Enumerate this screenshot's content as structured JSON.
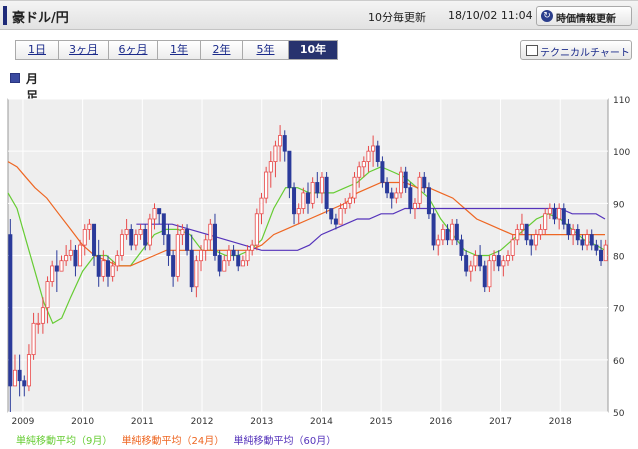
{
  "header": {
    "title": "豪ドル/円",
    "frequency": "10分毎更新",
    "timestamp": "18/10/02 11:04",
    "refresh_label": "時価情報更新"
  },
  "tabs": [
    {
      "label": "1日",
      "active": false
    },
    {
      "label": "3ヶ月",
      "active": false
    },
    {
      "label": "6ヶ月",
      "active": false
    },
    {
      "label": "1年",
      "active": false
    },
    {
      "label": "2年",
      "active": false
    },
    {
      "label": "5年",
      "active": false
    },
    {
      "label": "10年",
      "active": true
    }
  ],
  "technical_label": "テクニカルチャート",
  "section_title": "月足",
  "legend": [
    {
      "label": "単純移動平均（9月）",
      "color": "#66cc33"
    },
    {
      "label": "単純移動平均（24月）",
      "color": "#ee6622"
    },
    {
      "label": "単純移動平均（60月）",
      "color": "#5533bb"
    }
  ],
  "chart_data": {
    "type": "candlestick",
    "x_tick_labels": [
      "2009",
      "2010",
      "2011",
      "2012",
      "2013",
      "2014",
      "2015",
      "2016",
      "2017",
      "2018"
    ],
    "y_tick_labels": [
      "50",
      "60",
      "70",
      "80",
      "90",
      "100",
      "110"
    ],
    "ylim": [
      50,
      110
    ],
    "x_range": [
      "2008-10",
      "2018-10"
    ],
    "grid": true,
    "colors": {
      "up": "#e84a4a",
      "down": "#2a3a9a"
    },
    "candles": [
      [
        84,
        87,
        50,
        55
      ],
      [
        55,
        61,
        55,
        58
      ],
      [
        58,
        61,
        53,
        56
      ],
      [
        56,
        57,
        53,
        55
      ],
      [
        55,
        63,
        54,
        61
      ],
      [
        61,
        69,
        60,
        67
      ],
      [
        67,
        69,
        65,
        67
      ],
      [
        67,
        72,
        65,
        70
      ],
      [
        70,
        76,
        67,
        75
      ],
      [
        75,
        79,
        74,
        78
      ],
      [
        78,
        81,
        73,
        77
      ],
      [
        77,
        80,
        77,
        79
      ],
      [
        79,
        82,
        78,
        80
      ],
      [
        80,
        83,
        79,
        81
      ],
      [
        81,
        82,
        76,
        78
      ],
      [
        78,
        83,
        78,
        82
      ],
      [
        82,
        86,
        80,
        85
      ],
      [
        85,
        87,
        83,
        86
      ],
      [
        86,
        86,
        78,
        80
      ],
      [
        80,
        83,
        74,
        76
      ],
      [
        76,
        81,
        75,
        79
      ],
      [
        79,
        80,
        74,
        76
      ],
      [
        76,
        79,
        75,
        78
      ],
      [
        78,
        81,
        77,
        80
      ],
      [
        80,
        85,
        79,
        84
      ],
      [
        84,
        87,
        83,
        85
      ],
      [
        85,
        86,
        81,
        82
      ],
      [
        82,
        85,
        81,
        84
      ],
      [
        84,
        86,
        83,
        85
      ],
      [
        85,
        86,
        81,
        82
      ],
      [
        82,
        88,
        81,
        87
      ],
      [
        87,
        90,
        85,
        89
      ],
      [
        89,
        89,
        86,
        88
      ],
      [
        88,
        88,
        82,
        84
      ],
      [
        84,
        86,
        78,
        80
      ],
      [
        80,
        81,
        74,
        76
      ],
      [
        76,
        86,
        75,
        84
      ],
      [
        84,
        86,
        82,
        85
      ],
      [
        85,
        86,
        80,
        81
      ],
      [
        81,
        84,
        73,
        74
      ],
      [
        74,
        80,
        72,
        79
      ],
      [
        79,
        82,
        77,
        81
      ],
      [
        81,
        84,
        79,
        83
      ],
      [
        83,
        87,
        81,
        86
      ],
      [
        86,
        88,
        79,
        80
      ],
      [
        80,
        81,
        76,
        77
      ],
      [
        77,
        80,
        77,
        79
      ],
      [
        79,
        82,
        78,
        81
      ],
      [
        81,
        82,
        79,
        80
      ],
      [
        80,
        81,
        77,
        78
      ],
      [
        78,
        80,
        78,
        79
      ],
      [
        79,
        82,
        78,
        81
      ],
      [
        81,
        83,
        80,
        82
      ],
      [
        82,
        89,
        81,
        88
      ],
      [
        88,
        92,
        86,
        91
      ],
      [
        91,
        97,
        90,
        96
      ],
      [
        96,
        100,
        93,
        98
      ],
      [
        98,
        102,
        95,
        101
      ],
      [
        101,
        105,
        98,
        103
      ],
      [
        103,
        104,
        98,
        100
      ],
      [
        100,
        100,
        91,
        93
      ],
      [
        93,
        94,
        86,
        88
      ],
      [
        88,
        90,
        86,
        89
      ],
      [
        89,
        93,
        88,
        92
      ],
      [
        92,
        94,
        88,
        90
      ],
      [
        90,
        95,
        89,
        94
      ],
      [
        94,
        96,
        91,
        92
      ],
      [
        92,
        96,
        90,
        95
      ],
      [
        95,
        96,
        88,
        89
      ],
      [
        89,
        89,
        86,
        87
      ],
      [
        87,
        88,
        85,
        86
      ],
      [
        86,
        90,
        86,
        89
      ],
      [
        89,
        91,
        88,
        90
      ],
      [
        90,
        92,
        89,
        91
      ],
      [
        91,
        96,
        90,
        95
      ],
      [
        95,
        98,
        93,
        97
      ],
      [
        97,
        99,
        95,
        98
      ],
      [
        98,
        101,
        96,
        100
      ],
      [
        100,
        103,
        97,
        101
      ],
      [
        101,
        102,
        97,
        98
      ],
      [
        98,
        99,
        93,
        94
      ],
      [
        94,
        95,
        91,
        92
      ],
      [
        92,
        93,
        89,
        91
      ],
      [
        91,
        93,
        90,
        92
      ],
      [
        92,
        97,
        91,
        96
      ],
      [
        96,
        97,
        92,
        93
      ],
      [
        93,
        94,
        88,
        89
      ],
      [
        89,
        91,
        87,
        90
      ],
      [
        90,
        96,
        89,
        95
      ],
      [
        95,
        96,
        92,
        93
      ],
      [
        93,
        94,
        87,
        88
      ],
      [
        88,
        89,
        81,
        82
      ],
      [
        82,
        84,
        80,
        83
      ],
      [
        83,
        86,
        82,
        85
      ],
      [
        85,
        86,
        82,
        83
      ],
      [
        83,
        87,
        82,
        86
      ],
      [
        86,
        87,
        82,
        83
      ],
      [
        83,
        84,
        79,
        80
      ],
      [
        80,
        81,
        76,
        77
      ],
      [
        77,
        79,
        75,
        78
      ],
      [
        78,
        81,
        77,
        80
      ],
      [
        80,
        82,
        77,
        78
      ],
      [
        78,
        79,
        73,
        74
      ],
      [
        74,
        80,
        73,
        79
      ],
      [
        79,
        81,
        77,
        80
      ],
      [
        80,
        81,
        77,
        78
      ],
      [
        78,
        80,
        76,
        79
      ],
      [
        79,
        81,
        78,
        80
      ],
      [
        80,
        84,
        79,
        83
      ],
      [
        83,
        86,
        82,
        85
      ],
      [
        85,
        88,
        84,
        86
      ],
      [
        86,
        86,
        82,
        83
      ],
      [
        83,
        84,
        80,
        82
      ],
      [
        82,
        85,
        81,
        84
      ],
      [
        84,
        86,
        83,
        85
      ],
      [
        85,
        89,
        84,
        88
      ],
      [
        88,
        90,
        87,
        89
      ],
      [
        89,
        90,
        86,
        87
      ],
      [
        87,
        90,
        85,
        89
      ],
      [
        89,
        90,
        85,
        86
      ],
      [
        86,
        87,
        83,
        84
      ],
      [
        84,
        86,
        82,
        85
      ],
      [
        85,
        86,
        82,
        83
      ],
      [
        83,
        84,
        81,
        82
      ],
      [
        82,
        85,
        81,
        84
      ],
      [
        84,
        85,
        81,
        82
      ],
      [
        82,
        83,
        80,
        81
      ],
      [
        81,
        83,
        78,
        79
      ],
      [
        79,
        83,
        79,
        82
      ]
    ],
    "series": [
      {
        "name": "単純移動平均（9月）",
        "color": "#66cc33",
        "values": [
          [
            2008.75,
            92
          ],
          [
            2008.9,
            89
          ],
          [
            2009.05,
            83
          ],
          [
            2009.2,
            77
          ],
          [
            2009.35,
            71
          ],
          [
            2009.5,
            67
          ],
          [
            2009.65,
            68
          ],
          [
            2009.8,
            72
          ],
          [
            2010.0,
            77
          ],
          [
            2010.2,
            80
          ],
          [
            2010.4,
            80
          ],
          [
            2010.6,
            78
          ],
          [
            2010.8,
            78
          ],
          [
            2011.0,
            81
          ],
          [
            2011.2,
            84
          ],
          [
            2011.4,
            85
          ],
          [
            2011.6,
            85
          ],
          [
            2011.8,
            84
          ],
          [
            2012.0,
            81
          ],
          [
            2012.2,
            81
          ],
          [
            2012.4,
            80
          ],
          [
            2012.6,
            80
          ],
          [
            2012.8,
            81
          ],
          [
            2013.0,
            83
          ],
          [
            2013.2,
            89
          ],
          [
            2013.4,
            93
          ],
          [
            2013.6,
            93
          ],
          [
            2013.8,
            92
          ],
          [
            2014.0,
            92
          ],
          [
            2014.2,
            92
          ],
          [
            2014.4,
            93
          ],
          [
            2014.6,
            94
          ],
          [
            2014.8,
            96
          ],
          [
            2015.0,
            97
          ],
          [
            2015.2,
            96
          ],
          [
            2015.4,
            95
          ],
          [
            2015.6,
            93
          ],
          [
            2015.8,
            91
          ],
          [
            2016.0,
            87
          ],
          [
            2016.2,
            84
          ],
          [
            2016.4,
            81
          ],
          [
            2016.6,
            80
          ],
          [
            2016.8,
            80
          ],
          [
            2017.0,
            81
          ],
          [
            2017.2,
            83
          ],
          [
            2017.4,
            85
          ],
          [
            2017.6,
            87
          ],
          [
            2017.8,
            88
          ],
          [
            2018.0,
            87
          ],
          [
            2018.2,
            85
          ],
          [
            2018.4,
            83
          ],
          [
            2018.6,
            82
          ],
          [
            2018.75,
            81
          ]
        ]
      },
      {
        "name": "単純移動平均（24月）",
        "color": "#ee6622",
        "values": [
          [
            2008.75,
            98
          ],
          [
            2008.9,
            97
          ],
          [
            2009.05,
            95
          ],
          [
            2009.2,
            93
          ],
          [
            2009.4,
            91
          ],
          [
            2009.6,
            88
          ],
          [
            2009.8,
            85
          ],
          [
            2010.0,
            82
          ],
          [
            2010.2,
            80
          ],
          [
            2010.4,
            79
          ],
          [
            2010.6,
            78
          ],
          [
            2010.8,
            78
          ],
          [
            2011.0,
            79
          ],
          [
            2011.2,
            80
          ],
          [
            2011.4,
            81
          ],
          [
            2011.6,
            81
          ],
          [
            2011.8,
            81
          ],
          [
            2012.0,
            81
          ],
          [
            2012.2,
            81
          ],
          [
            2012.4,
            81
          ],
          [
            2012.6,
            81
          ],
          [
            2012.8,
            81
          ],
          [
            2013.0,
            82
          ],
          [
            2013.2,
            84
          ],
          [
            2013.4,
            85
          ],
          [
            2013.6,
            86
          ],
          [
            2013.8,
            87
          ],
          [
            2014.0,
            88
          ],
          [
            2014.2,
            89
          ],
          [
            2014.4,
            90
          ],
          [
            2014.6,
            92
          ],
          [
            2014.8,
            93
          ],
          [
            2015.0,
            94
          ],
          [
            2015.2,
            94
          ],
          [
            2015.4,
            94
          ],
          [
            2015.6,
            93
          ],
          [
            2015.8,
            93
          ],
          [
            2016.0,
            92
          ],
          [
            2016.2,
            91
          ],
          [
            2016.4,
            89
          ],
          [
            2016.6,
            87
          ],
          [
            2016.8,
            86
          ],
          [
            2017.0,
            85
          ],
          [
            2017.2,
            84
          ],
          [
            2017.4,
            84
          ],
          [
            2017.6,
            84
          ],
          [
            2017.8,
            84
          ],
          [
            2018.0,
            84
          ],
          [
            2018.2,
            84
          ],
          [
            2018.4,
            84
          ],
          [
            2018.6,
            84
          ],
          [
            2018.75,
            84
          ]
        ]
      },
      {
        "name": "単純移動平均（60月）",
        "color": "#5533bb",
        "values": [
          [
            2010.9,
            86
          ],
          [
            2011.2,
            86
          ],
          [
            2011.5,
            86
          ],
          [
            2011.8,
            85
          ],
          [
            2012.1,
            84
          ],
          [
            2012.4,
            83
          ],
          [
            2012.7,
            82
          ],
          [
            2013.0,
            81
          ],
          [
            2013.3,
            81
          ],
          [
            2013.6,
            81
          ],
          [
            2013.8,
            82
          ],
          [
            2014.0,
            84
          ],
          [
            2014.2,
            85
          ],
          [
            2014.4,
            86
          ],
          [
            2014.6,
            87
          ],
          [
            2014.8,
            87
          ],
          [
            2015.0,
            88
          ],
          [
            2015.2,
            88
          ],
          [
            2015.4,
            89
          ],
          [
            2015.6,
            89
          ],
          [
            2015.8,
            89
          ],
          [
            2016.0,
            89
          ],
          [
            2016.2,
            89
          ],
          [
            2016.4,
            89
          ],
          [
            2016.6,
            89
          ],
          [
            2016.8,
            89
          ],
          [
            2017.0,
            89
          ],
          [
            2017.2,
            89
          ],
          [
            2017.4,
            89
          ],
          [
            2017.6,
            89
          ],
          [
            2017.8,
            89
          ],
          [
            2018.0,
            89
          ],
          [
            2018.2,
            88
          ],
          [
            2018.4,
            88
          ],
          [
            2018.6,
            88
          ],
          [
            2018.75,
            87
          ]
        ]
      }
    ]
  }
}
